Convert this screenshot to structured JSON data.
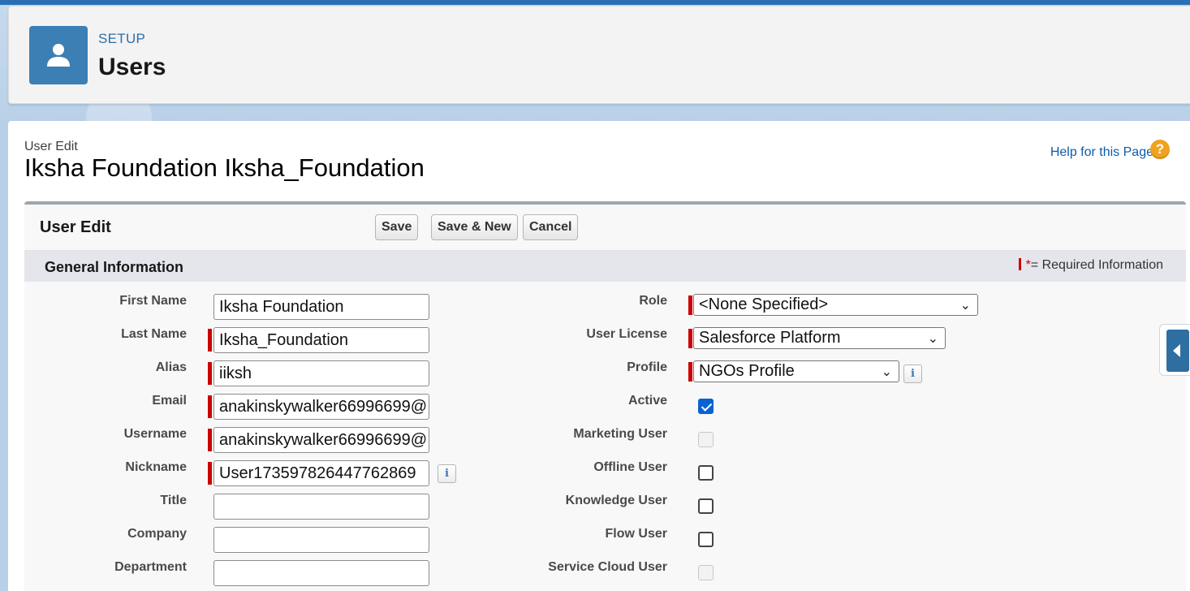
{
  "header": {
    "setup_label": "SETUP",
    "title": "Users",
    "icon": "user-icon"
  },
  "page": {
    "type_label": "User Edit",
    "name": "Iksha Foundation Iksha_Foundation",
    "help_link": "Help for this Page",
    "help_icon": "?"
  },
  "edit": {
    "title": "User Edit",
    "buttons": {
      "save": "Save",
      "save_new": "Save & New",
      "cancel": "Cancel"
    }
  },
  "section": {
    "title": "General Information",
    "required_star": "*",
    "required_text": "= Required Information"
  },
  "left_fields": [
    {
      "label": "First Name",
      "value": "Iksha Foundation",
      "required": false
    },
    {
      "label": "Last Name",
      "value": "Iksha_Foundation",
      "required": true
    },
    {
      "label": "Alias",
      "value": "iiksh",
      "required": true
    },
    {
      "label": "Email",
      "value": "anakinskywalker66996699@",
      "required": true
    },
    {
      "label": "Username",
      "value": "anakinskywalker66996699@",
      "required": true
    },
    {
      "label": "Nickname",
      "value": "User173597826447762869",
      "required": true,
      "info": "i"
    },
    {
      "label": "Title",
      "value": "",
      "required": false
    },
    {
      "label": "Company",
      "value": "",
      "required": false
    },
    {
      "label": "Department",
      "value": "",
      "required": false
    }
  ],
  "right_selects": [
    {
      "label": "Role",
      "value": "<None Specified>",
      "required": true
    },
    {
      "label": "User License",
      "value": "Salesforce Platform",
      "required": true
    },
    {
      "label": "Profile",
      "value": "NGOs Profile",
      "required": true,
      "info": "i"
    }
  ],
  "right_checkboxes": [
    {
      "label": "Active",
      "checked": true,
      "disabled": false
    },
    {
      "label": "Marketing User",
      "checked": false,
      "disabled": true
    },
    {
      "label": "Offline User",
      "checked": false,
      "disabled": false
    },
    {
      "label": "Knowledge User",
      "checked": false,
      "disabled": false
    },
    {
      "label": "Flow User",
      "checked": false,
      "disabled": false
    },
    {
      "label": "Service Cloud User",
      "checked": false,
      "disabled": true
    }
  ],
  "colors": {
    "brand_blue": "#3c7fb5",
    "required_red": "#c00000",
    "link_blue": "#0b5cab",
    "checkbox_blue": "#0a62d0"
  }
}
